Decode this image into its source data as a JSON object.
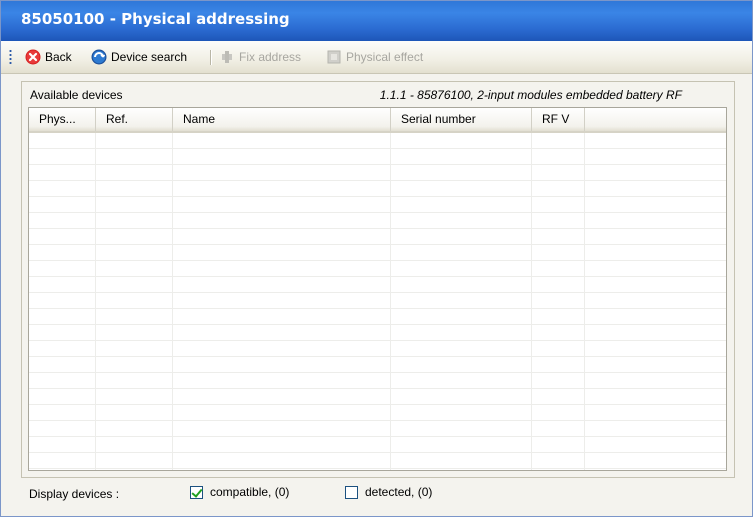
{
  "window": {
    "title": "85050100 - Physical addressing"
  },
  "toolbar": {
    "back_label": "Back",
    "device_search_label": "Device search",
    "fix_address_label": "Fix address",
    "physical_effect_label": "Physical effect"
  },
  "panel": {
    "available_label": "Available devices",
    "selection_info": "1.1.1 - 85876100, 2-input modules embedded battery RF"
  },
  "table": {
    "columns": [
      "Phys...",
      "Ref.",
      "Name",
      "Serial number",
      "RF V"
    ],
    "rows": []
  },
  "footer": {
    "display_label": "Display devices :",
    "compatible": {
      "label": "compatible, (0)",
      "checked": true
    },
    "detected": {
      "label": "detected, (0)",
      "checked": false
    }
  },
  "colors": {
    "titlebar": "#2f77d8",
    "window_bg": "#f4f3ee",
    "checkmark": "#21a121"
  }
}
